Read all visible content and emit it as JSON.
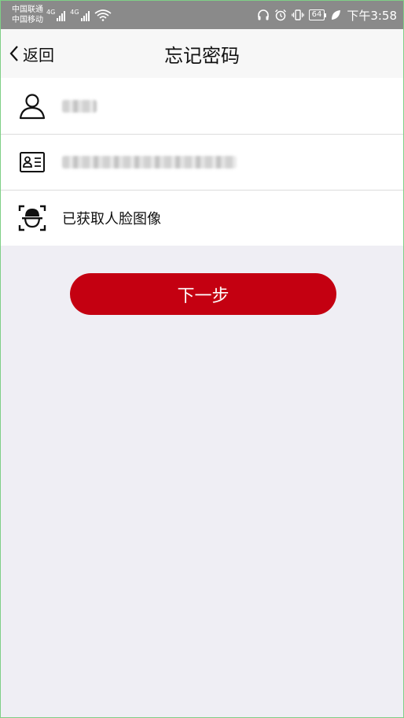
{
  "status_bar": {
    "carrier_1": "中国联通",
    "carrier_2": "中国移动",
    "network_1": "4G",
    "network_2": "4G",
    "battery": "64",
    "time": "下午3:58"
  },
  "nav": {
    "back_label": "返回",
    "title": "忘记密码"
  },
  "form": {
    "face_status": "已获取人脸图像"
  },
  "actions": {
    "next_label": "下一步"
  },
  "colors": {
    "accent": "#c40011",
    "status_bar_bg": "#8a8a8a",
    "page_bg": "#efeef4"
  }
}
